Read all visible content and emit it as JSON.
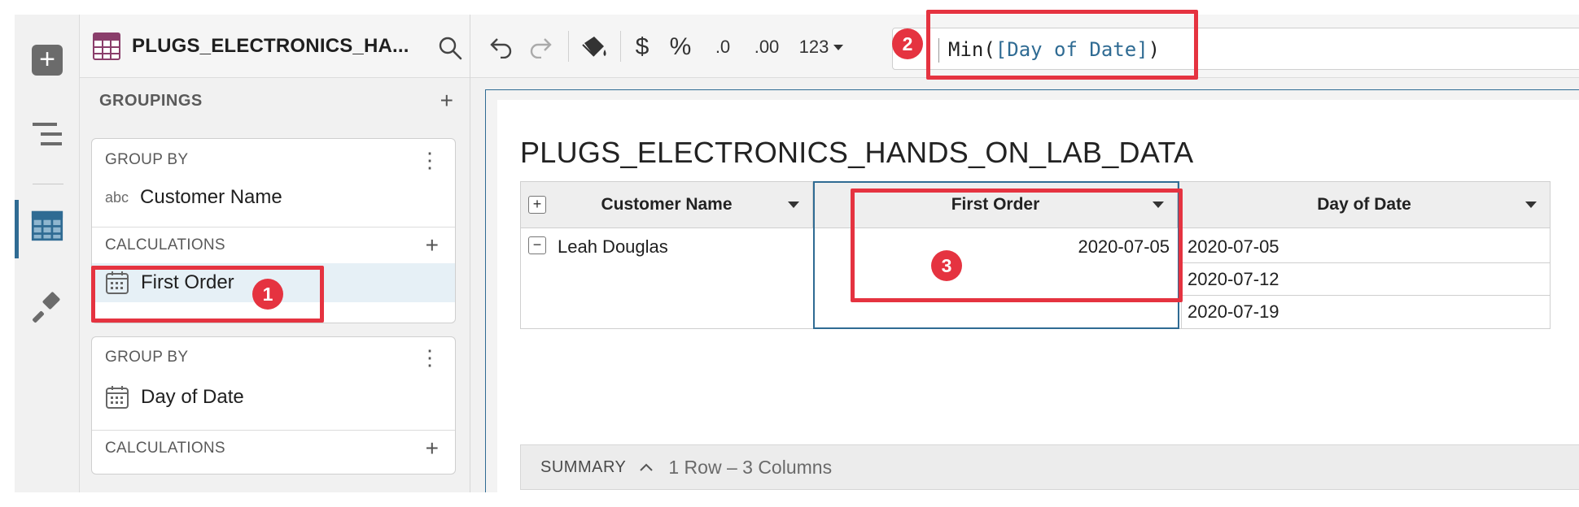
{
  "app": {
    "title": "PLUGS_ELECTRONICS_HA..."
  },
  "rail": {
    "icons": [
      "add-icon",
      "layers-icon",
      "table-icon",
      "brush-icon"
    ]
  },
  "panel": {
    "groupings_label": "GROUPINGS",
    "group1": {
      "group_by_label": "GROUP BY",
      "type_prefix": "abc",
      "column": "Customer Name",
      "calculations_label": "CALCULATIONS",
      "calc_item": "First Order"
    },
    "group2": {
      "group_by_label": "GROUP BY",
      "column": "Day of Date",
      "calculations_label": "CALCULATIONS"
    }
  },
  "toolbar": {
    "dollar": "$",
    "percent": "%",
    "dec_less": ".0",
    "dec_more": ".00",
    "format": "123",
    "formula_func_open": "Min(",
    "formula_ref": "[Day of Date]",
    "formula_close": ")"
  },
  "sheet": {
    "title": "PLUGS_ELECTRONICS_HANDS_ON_LAB_DATA",
    "columns": [
      "Customer Name",
      "First Order",
      "Day of Date"
    ],
    "row_customer": "Leah Douglas",
    "row_first_order": "2020-07-05",
    "days": [
      "2020-07-05",
      "2020-07-12",
      "2020-07-19"
    ],
    "expand_symbol": "+",
    "collapse_symbol": "−"
  },
  "summary": {
    "label": "SUMMARY",
    "info": "1 Row – 3 Columns"
  },
  "annotations": {
    "badge1": "1",
    "badge2": "2",
    "badge3": "3",
    "color": "#e53340"
  },
  "colors": {
    "accent": "#2f6b93",
    "selected_row": "#e6f0f6"
  }
}
